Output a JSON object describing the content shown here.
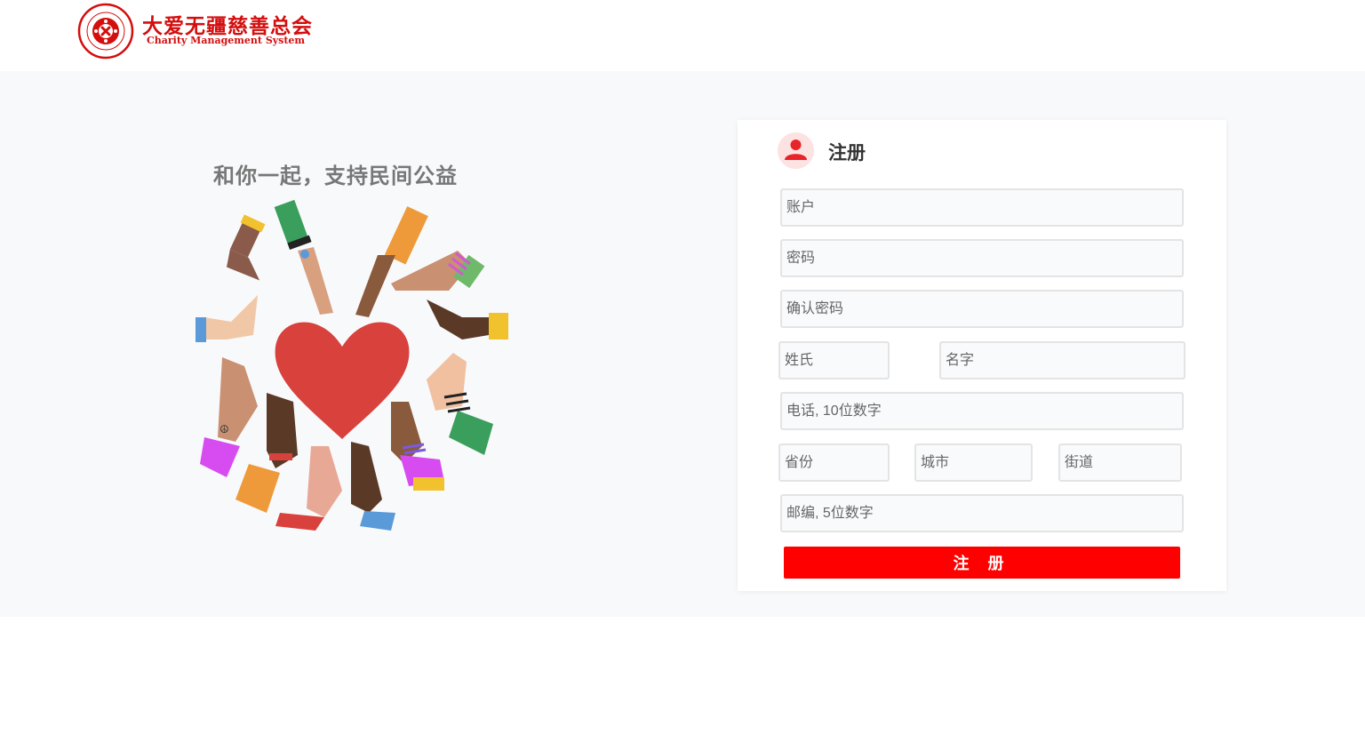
{
  "header": {
    "logo_cn": "大爱无疆慈善总会",
    "logo_en": "Charity Management System"
  },
  "hero": {
    "slogan": "和你一起，支持民间公益",
    "illustration": "hands-around-heart"
  },
  "form": {
    "title": "注册",
    "icon": "user-icon",
    "fields": {
      "account": "账户",
      "password": "密码",
      "confirm_password": "确认密码",
      "last_name": "姓氏",
      "first_name": "名字",
      "phone": "电话, 10位数字",
      "province": "省份",
      "city": "城市",
      "street": "街道",
      "zipcode": "邮编, 5位数字"
    },
    "submit_label": "注 册"
  },
  "colors": {
    "brand_red": "#d40d0d",
    "button_red": "#ff0000",
    "heart_red": "#d9413d"
  }
}
